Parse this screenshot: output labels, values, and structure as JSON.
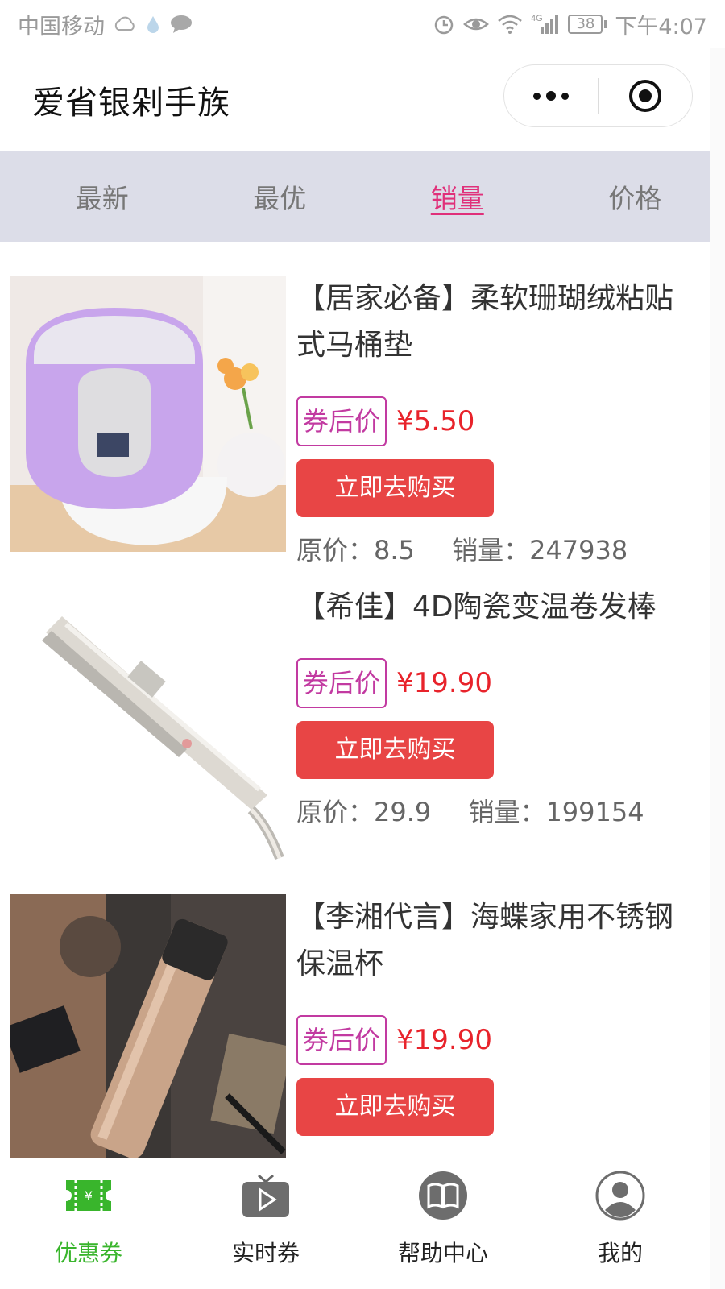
{
  "status_bar": {
    "carrier": "中国移动",
    "network": "4G",
    "battery": "38",
    "time": "下午4:07"
  },
  "header": {
    "title": "爱省银剁手族"
  },
  "tabs": [
    {
      "label": "最新",
      "active": false
    },
    {
      "label": "最优",
      "active": false
    },
    {
      "label": "销量",
      "active": true
    },
    {
      "label": "价格",
      "active": false
    }
  ],
  "products": [
    {
      "title": "【居家必备】柔软珊瑚绒粘贴式马桶垫",
      "coupon_label": "券后价",
      "price": "¥5.50",
      "buy_label": "立即去购买",
      "original_price": "原价：8.5",
      "sales": "销量：247938"
    },
    {
      "title": "【希佳】4D陶瓷变温卷发棒",
      "coupon_label": "券后价",
      "price": "¥19.90",
      "buy_label": "立即去购买",
      "original_price": "原价：29.9",
      "sales": "销量：199154"
    },
    {
      "title": "【李湘代言】海蝶家用不锈钢保温杯",
      "coupon_label": "券后价",
      "price": "¥19.90",
      "buy_label": "立即去购买",
      "original_price": "",
      "sales": ""
    }
  ],
  "bottom_nav": [
    {
      "label": "优惠券",
      "icon": "coupon-icon",
      "active": true
    },
    {
      "label": "实时券",
      "icon": "tv-play-icon",
      "active": false
    },
    {
      "label": "帮助中心",
      "icon": "book-icon",
      "active": false
    },
    {
      "label": "我的",
      "icon": "user-icon",
      "active": false
    }
  ],
  "colors": {
    "accent_pink": "#e0307a",
    "coupon_border": "#c23aa1",
    "price_red": "#e8232b",
    "buy_button": "#e84545",
    "nav_active": "#39b52c",
    "tabs_bg": "#dcdde8"
  }
}
